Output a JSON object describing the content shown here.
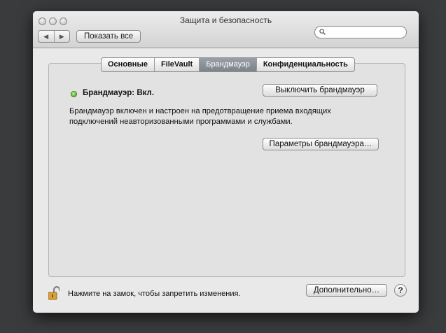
{
  "window": {
    "title": "Защита и безопасность",
    "show_all_label": "Показать все"
  },
  "nav": {
    "back_icon": "back-arrow-icon",
    "forward_icon": "forward-arrow-icon"
  },
  "search": {
    "placeholder": "",
    "icon": "search-icon"
  },
  "tabs": [
    {
      "label": "Основные",
      "active": false
    },
    {
      "label": "FileVault",
      "active": false
    },
    {
      "label": "Брандмауэр",
      "active": true
    },
    {
      "label": "Конфиденциальность",
      "active": false
    }
  ],
  "firewall": {
    "status_label": "Брандмауэр: Вкл.",
    "status_color": "#3f9a1c",
    "turn_off_button": "Выключить брандмауэр",
    "description": "Брандмауэр включен и настроен на предотвращение приема входящих подключений неавторизованными программами и службами.",
    "options_button": "Параметры брандмауэра…"
  },
  "footer": {
    "lock_text": "Нажмите на замок, чтобы запретить изменения.",
    "advanced_button": "Дополнительно…",
    "help_label": "?",
    "lock_icon": "lock-open-icon"
  }
}
